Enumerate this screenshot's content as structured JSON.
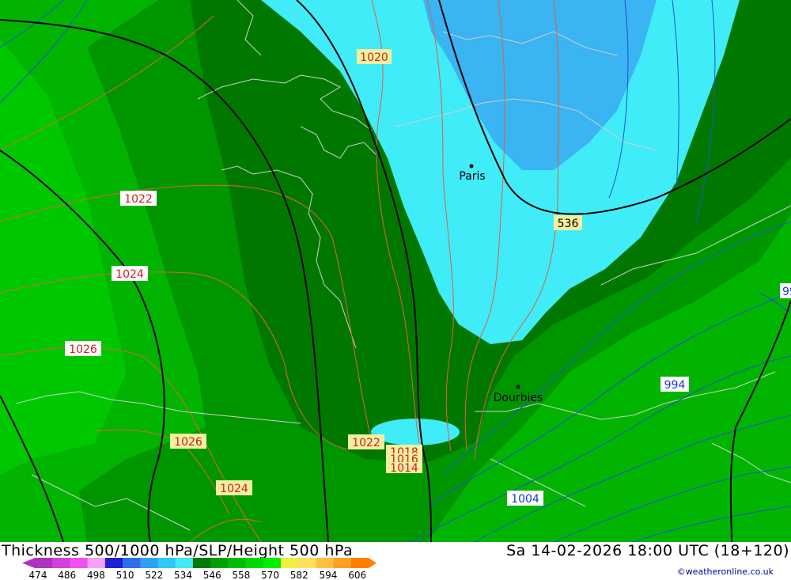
{
  "title": "Thickness 500/1000 hPa/SLP/Height 500 hPa",
  "datetime": "Sa 14-02-2026 18:00 UTC (18+120)",
  "credit": "©weatheronline.co.uk",
  "cities": [
    {
      "name": "Paris"
    },
    {
      "name": "Dourbies"
    }
  ],
  "isobar_labels": [
    "1020",
    "1022",
    "1024",
    "1026",
    "1026",
    "1024",
    "1022",
    "1018",
    "1016",
    "1014",
    "1004",
    "994",
    "99"
  ],
  "height_label": "536",
  "legend": {
    "values": [
      "474",
      "486",
      "498",
      "510",
      "522",
      "534",
      "546",
      "558",
      "570",
      "582",
      "594",
      "606"
    ],
    "colors": [
      "#b030c0",
      "#d040e0",
      "#f050f0",
      "#f8a0f8",
      "#2020d0",
      "#2f6fe6",
      "#30a0f0",
      "#30c8f8",
      "#40e8f8",
      "#007a00",
      "#00a000",
      "#00bd00",
      "#00d800",
      "#00f000",
      "#f0f040",
      "#ffe060",
      "#ffc040",
      "#ffa020",
      "#ff8000"
    ]
  }
}
